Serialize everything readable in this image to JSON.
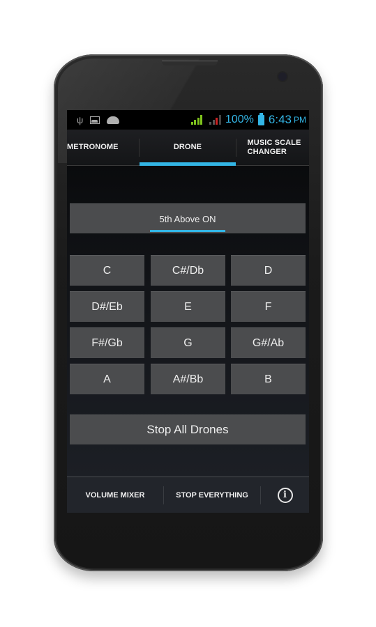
{
  "status_bar": {
    "left_icons": [
      "usb-icon",
      "image-icon",
      "android-icon"
    ],
    "signal_colors": {
      "wifi": "#7fc31c",
      "cell": "#cc2222"
    },
    "battery_percent": "100%",
    "time": "6:43",
    "ampm": "PM"
  },
  "tabs": [
    {
      "label": "METRONOME",
      "selected": false
    },
    {
      "label": "DRONE",
      "selected": true
    },
    {
      "label": "MUSIC SCALE CHANGER",
      "selected": false
    }
  ],
  "drone": {
    "toggle_label": "5th Above ON",
    "toggle_on": true,
    "notes": [
      "C",
      "C#/Db",
      "D",
      "D#/Eb",
      "E",
      "F",
      "F#/Gb",
      "G",
      "G#/Ab",
      "A",
      "A#/Bb",
      "B"
    ],
    "stop_all_label": "Stop All Drones"
  },
  "bottom_bar": {
    "volume_mixer": "VOLUME MIXER",
    "stop_everything": "STOP EVERYTHING",
    "info_glyph": "i"
  },
  "colors": {
    "accent": "#33b5e5",
    "button_bg": "#4b4c4e",
    "screen_bg": "#0b0c0f"
  }
}
